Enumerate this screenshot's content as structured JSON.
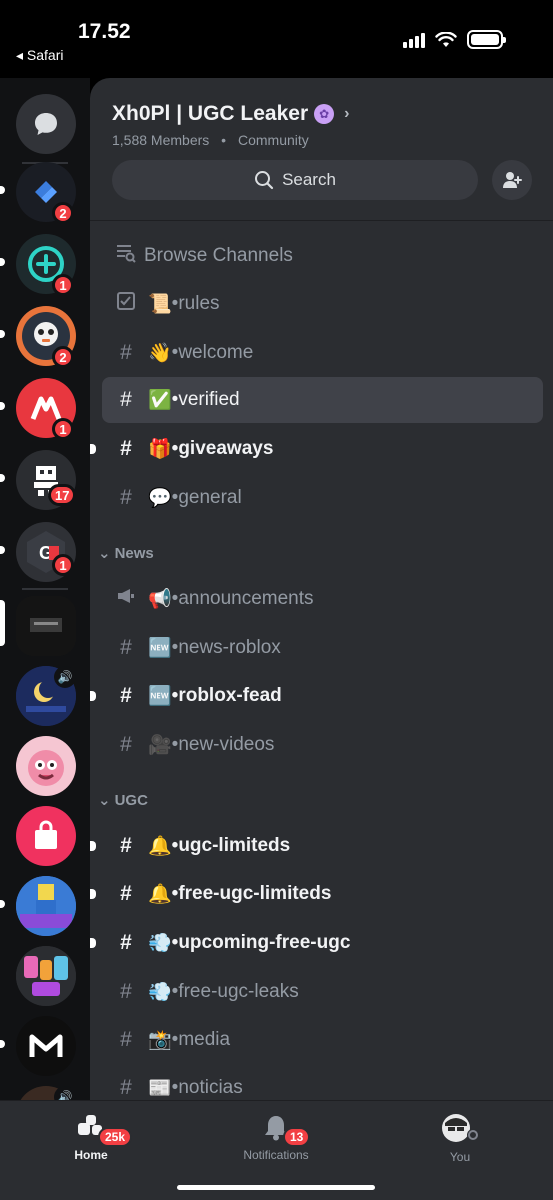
{
  "status_bar": {
    "time": "17.52",
    "back_app": "◂ Safari"
  },
  "server": {
    "name": "Xh0Pl | UGC Leaker",
    "members": "1,588 Members",
    "type": "Community",
    "search_label": "Search"
  },
  "rail": {
    "badges": [
      "2",
      "1",
      "2",
      "1",
      "17",
      "1"
    ]
  },
  "channels": {
    "browse": "Browse Channels",
    "top": [
      {
        "emoji": "📜",
        "name": "•rules",
        "icon": "rules-icon"
      },
      {
        "emoji": "👋",
        "name": "•welcome",
        "icon": "hash-icon"
      },
      {
        "emoji": "✅",
        "name": "•verified",
        "icon": "hash-icon"
      },
      {
        "emoji": "🎁",
        "name": "•giveaways",
        "icon": "hash-icon"
      },
      {
        "emoji": "💬",
        "name": "•general",
        "icon": "hash-icon"
      }
    ],
    "news_label": "News",
    "news": [
      {
        "emoji": "📢",
        "name": "•announcements",
        "icon": "megaphone-icon"
      },
      {
        "emoji": "🆕",
        "name": "•news-roblox",
        "icon": "hash-icon"
      },
      {
        "emoji": "🆕",
        "name": "•roblox-fead",
        "icon": "hash-icon"
      },
      {
        "emoji": "🎥",
        "name": "•new-videos",
        "icon": "hash-icon"
      }
    ],
    "ugc_label": "UGC",
    "ugc": [
      {
        "emoji": "🔔",
        "name": "•ugc-limiteds",
        "icon": "hash-icon"
      },
      {
        "emoji": "🔔",
        "name": "•free-ugc-limiteds",
        "icon": "hash-icon"
      },
      {
        "emoji": "💨",
        "name": "•upcoming-free-ugc",
        "icon": "hash-icon"
      },
      {
        "emoji": "💨",
        "name": "•free-ugc-leaks",
        "icon": "hash-icon"
      },
      {
        "emoji": "📸",
        "name": "•media",
        "icon": "hash-icon"
      },
      {
        "emoji": "📰",
        "name": "•noticias",
        "icon": "hash-icon"
      }
    ]
  },
  "bottom_nav": {
    "home": "Home",
    "home_badge": "25k",
    "notifications": "Notifications",
    "notifications_badge": "13",
    "you": "You"
  },
  "colors": {
    "background": "#2b2d31",
    "rail": "#111214",
    "badge": "#f23f43",
    "accent_blue": "#5865f2"
  }
}
